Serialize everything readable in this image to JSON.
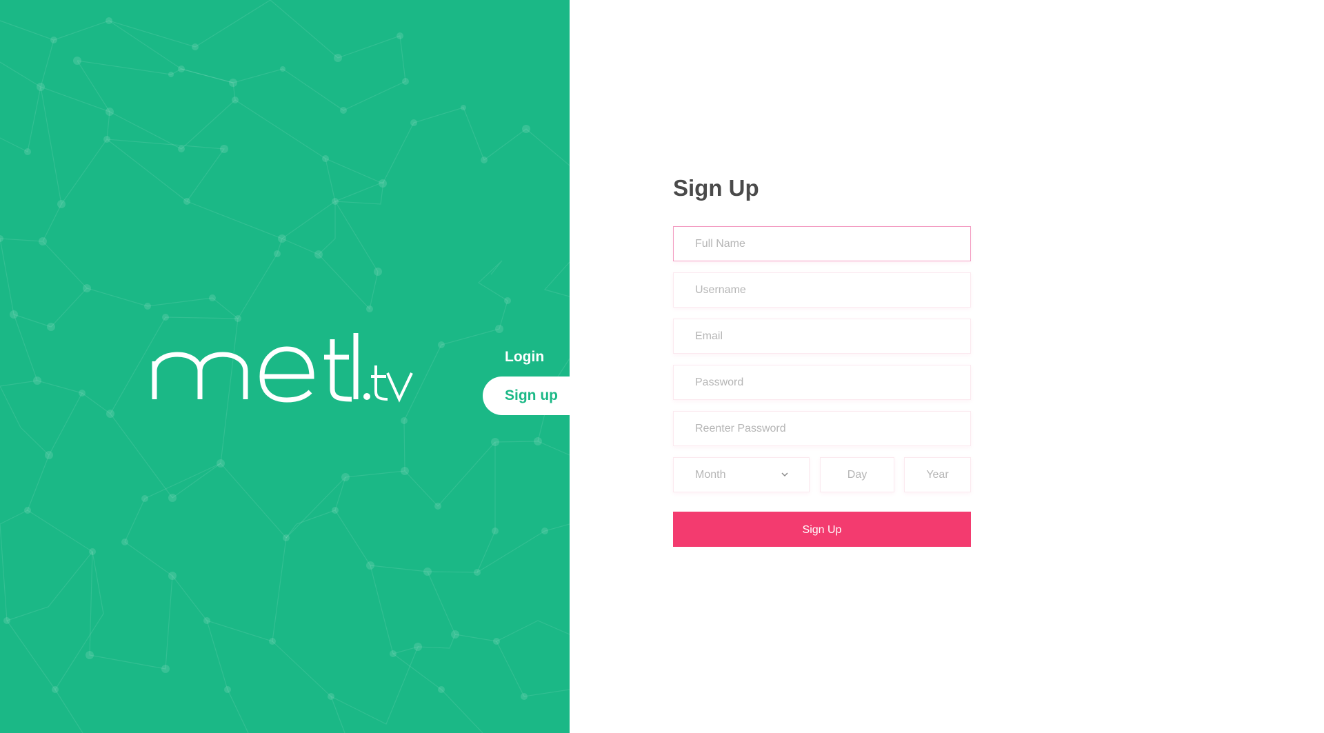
{
  "brand": {
    "logo_text": "metl.tv",
    "primary_color": "#1bb886",
    "accent_color": "#f33b6f"
  },
  "nav": {
    "login_label": "Login",
    "signup_label": "Sign up",
    "active": "signup"
  },
  "form": {
    "title": "Sign Up",
    "full_name_placeholder": "Full Name",
    "username_placeholder": "Username",
    "email_placeholder": "Email",
    "password_placeholder": "Password",
    "reenter_password_placeholder": "Reenter Password",
    "month_placeholder": "Month",
    "day_placeholder": "Day",
    "year_placeholder": "Year",
    "submit_label": "Sign Up"
  }
}
